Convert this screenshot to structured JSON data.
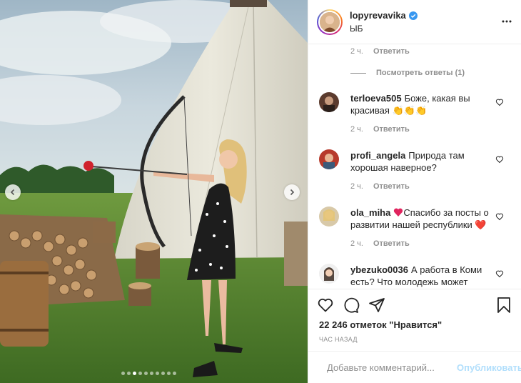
{
  "post": {
    "username": "lopyrevavika",
    "location": "ЫБ",
    "likes": "22 246 отметок \"Нравится\"",
    "time_ago": "ЧАС НАЗАД"
  },
  "first_meta": {
    "time": "2 ч.",
    "reply": "Ответить"
  },
  "view_replies": "Посмотреть ответы (1)",
  "comments": [
    {
      "user": "terloeva505",
      "text": "Боже, какая вы красивая",
      "emoji": "👏👏👏",
      "time": "2 ч.",
      "reply": "Ответить"
    },
    {
      "user": "profi_angela",
      "text": "Природа там хорошая наверное?",
      "emoji": "",
      "time": "2 ч.",
      "reply": "Ответить"
    },
    {
      "user": "ola_miha",
      "text": "Спасибо за посты о развитии нашей республики",
      "emoji": "❤️",
      "time": "2 ч.",
      "reply": "Ответить"
    },
    {
      "user": "ybezuko0036",
      "text": "А работа в Коми есть? Что молодежь может",
      "emoji": "",
      "time": "",
      "reply": ""
    }
  ],
  "add_comment": {
    "placeholder": "Добавьте комментарий...",
    "post_label": "Опубликовать"
  },
  "icons": {
    "like": "heart-icon",
    "comment": "comment-icon",
    "share": "share-icon",
    "save": "bookmark-icon",
    "emoji": "smiley-icon",
    "more": "more-dots-icon"
  },
  "colors": {
    "verified": "#3897f0",
    "post_button": "#b2dffc",
    "muted_text": "#8e8e8e"
  }
}
